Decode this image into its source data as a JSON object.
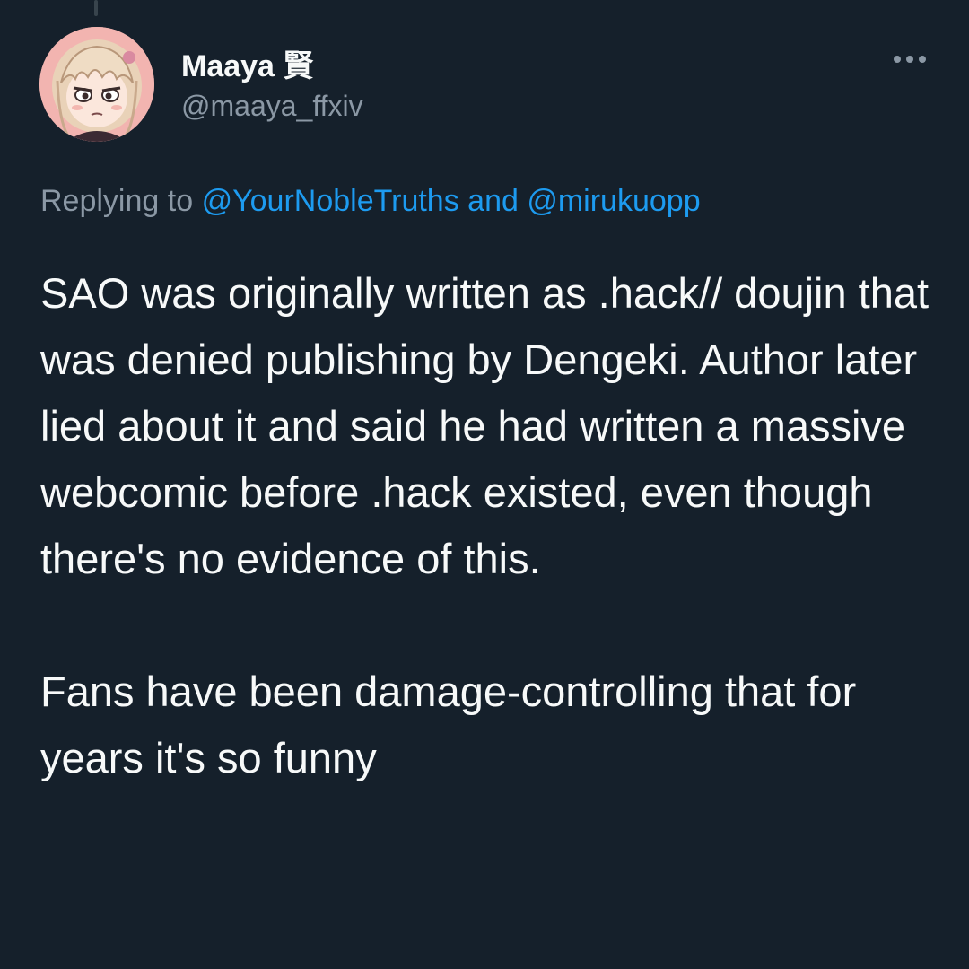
{
  "author": {
    "display_name": "Maaya 賢",
    "handle": "@maaya_ffxiv",
    "avatar_icon": "anime-girl-avatar"
  },
  "more_icon": "more-horizontal-icon",
  "reply_context": {
    "prefix": "Replying to",
    "mention_1": "@YourNobleTruths",
    "conjunction": "and",
    "mention_2": "@mirukuopp"
  },
  "tweet": {
    "text": "SAO was originally written as .hack// doujin that was denied publishing by Dengeki. Author later lied about it and said he had written a massive webcomic before .hack existed, even though there's no evidence of this.\n\nFans have been damage-controlling that for years it's so funny"
  },
  "colors": {
    "background": "#15202b",
    "text": "#f7f9f9",
    "secondary_text": "#8b98a5",
    "link": "#1d9bf0"
  }
}
